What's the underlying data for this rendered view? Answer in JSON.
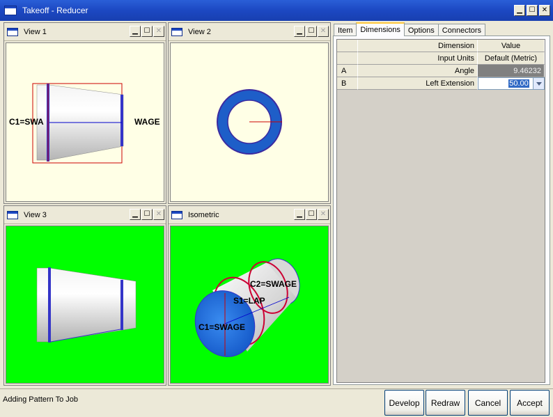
{
  "window": {
    "title": "Takeoff - Reducer",
    "controls": [
      "minimize-icon",
      "maximize-icon",
      "close-icon"
    ]
  },
  "views": [
    {
      "title": "View 1",
      "background": "#ffffe6",
      "labels": {
        "left": "C1=SWA",
        "right": "WAGE"
      }
    },
    {
      "title": "View 2",
      "background": "#ffffe6"
    },
    {
      "title": "View 3",
      "background": "#00ff00"
    },
    {
      "title": "Isometric",
      "background": "#00ff00",
      "labels": {
        "c2": "C2=SWAGE",
        "s1": "S1=LAP",
        "c1": "C1=SWAGE"
      }
    }
  ],
  "tabs": [
    {
      "label": "Item",
      "active": false
    },
    {
      "label": "Dimensions",
      "active": true
    },
    {
      "label": "Options",
      "active": false
    },
    {
      "label": "Connectors",
      "active": false
    }
  ],
  "grid": {
    "header": {
      "dimension": "Dimension",
      "value": "Value"
    },
    "units_row": {
      "label": "Input Units",
      "value": "Default (Metric)"
    },
    "rows": [
      {
        "id": "A",
        "label": "Angle",
        "value": "9.46232"
      },
      {
        "id": "B",
        "label": "Left Extension",
        "value": "50.00"
      }
    ]
  },
  "status": {
    "text": "Adding Pattern To Job"
  },
  "buttons": {
    "develop": "Develop",
    "redraw": "Redraw",
    "cancel": "Cancel",
    "accept": "Accept"
  },
  "colors": {
    "accent": "#1c48c2",
    "pipe_blue": "#1e6fe0",
    "edge_red": "#cc0000"
  }
}
